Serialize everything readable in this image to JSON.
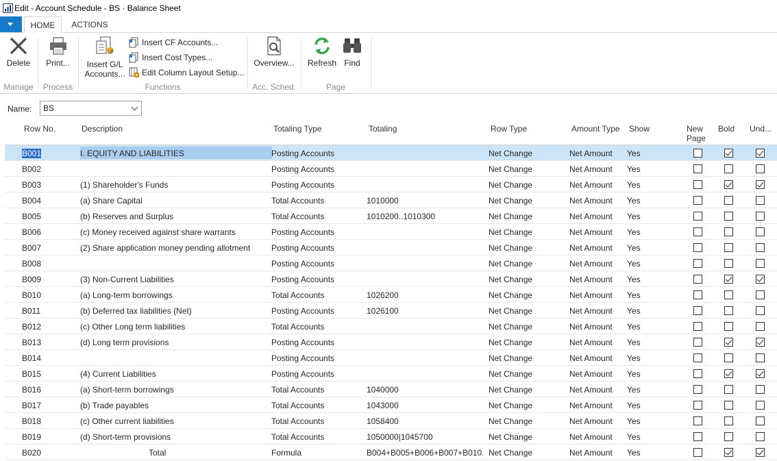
{
  "window": {
    "title": "Edit - Account Schedule - BS · Balance Sheet"
  },
  "tabs": {
    "home": "HOME",
    "actions": "ACTIONS"
  },
  "ribbon": {
    "manage": {
      "label": "Manage",
      "delete": "Delete"
    },
    "process": {
      "label": "Process",
      "print": "Print..."
    },
    "functions": {
      "label": "Functions",
      "insert_gl_line1": "Insert G/L",
      "insert_gl_line2": "Accounts...",
      "insert_cf": "Insert CF Accounts...",
      "insert_cost": "Insert Cost Types...",
      "edit_column": "Edit Column Layout Setup..."
    },
    "acc_sched": {
      "label": "Acc. Sched.",
      "overview": "Overview..."
    },
    "page": {
      "label": "Page",
      "refresh": "Refresh",
      "find": "Find"
    }
  },
  "name_field": {
    "label": "Name:",
    "value": "BS"
  },
  "columns": {
    "row_no": "Row No.",
    "description": "Description",
    "totaling_type": "Totaling Type",
    "totaling": "Totaling",
    "row_type": "Row Type",
    "amount_type": "Amount Type",
    "show": "Show",
    "new_page_1": "New",
    "new_page_2": "Page",
    "bold": "Bold",
    "underline": "Und..."
  },
  "rows": [
    {
      "row_no": "B001",
      "description": "I. EQUITY AND LIABILITIES",
      "totaling_type": "Posting Accounts",
      "totaling": "",
      "row_type": "Net Change",
      "amount_type": "Net Amount",
      "show": "Yes",
      "new_page": false,
      "bold": true,
      "underline": true
    },
    {
      "row_no": "B002",
      "description": "",
      "totaling_type": "Posting Accounts",
      "totaling": "",
      "row_type": "Net Change",
      "amount_type": "Net Amount",
      "show": "Yes",
      "new_page": false,
      "bold": false,
      "underline": false
    },
    {
      "row_no": "B003",
      "description": "(1) Shareholder's Funds",
      "totaling_type": "Posting Accounts",
      "totaling": "",
      "row_type": "Net Change",
      "amount_type": "Net Amount",
      "show": "Yes",
      "new_page": false,
      "bold": true,
      "underline": true
    },
    {
      "row_no": "B004",
      "description": "(a) Share Capital",
      "totaling_type": "Total Accounts",
      "totaling": "1010000",
      "row_type": "Net Change",
      "amount_type": "Net Amount",
      "show": "Yes",
      "new_page": false,
      "bold": false,
      "underline": false
    },
    {
      "row_no": "B005",
      "description": "(b) Reserves and Surplus",
      "totaling_type": "Total Accounts",
      "totaling": "1010200..1010300",
      "row_type": "Net Change",
      "amount_type": "Net Amount",
      "show": "Yes",
      "new_page": false,
      "bold": false,
      "underline": false
    },
    {
      "row_no": "B006",
      "description": "(c) Money received against share warrants",
      "totaling_type": "Posting Accounts",
      "totaling": "",
      "row_type": "Net Change",
      "amount_type": "Net Amount",
      "show": "Yes",
      "new_page": false,
      "bold": false,
      "underline": false
    },
    {
      "row_no": "B007",
      "description": "(2) Share application money pending allotment",
      "totaling_type": "Posting Accounts",
      "totaling": "",
      "row_type": "Net Change",
      "amount_type": "Net Amount",
      "show": "Yes",
      "new_page": false,
      "bold": false,
      "underline": false
    },
    {
      "row_no": "B008",
      "description": "",
      "totaling_type": "Posting Accounts",
      "totaling": "",
      "row_type": "Net Change",
      "amount_type": "Net Amount",
      "show": "Yes",
      "new_page": false,
      "bold": false,
      "underline": false
    },
    {
      "row_no": "B009",
      "description": "(3) Non-Current Liabilities",
      "totaling_type": "Posting Accounts",
      "totaling": "",
      "row_type": "Net Change",
      "amount_type": "Net Amount",
      "show": "Yes",
      "new_page": false,
      "bold": true,
      "underline": true
    },
    {
      "row_no": "B010",
      "description": "(a) Long-term borrowings",
      "totaling_type": "Total Accounts",
      "totaling": "1026200",
      "row_type": "Net Change",
      "amount_type": "Net Amount",
      "show": "Yes",
      "new_page": false,
      "bold": false,
      "underline": false
    },
    {
      "row_no": "B011",
      "description": "(b) Deferred tax liabilities (Net)",
      "totaling_type": "Posting Accounts",
      "totaling": "1026100",
      "row_type": "Net Change",
      "amount_type": "Net Amount",
      "show": "Yes",
      "new_page": false,
      "bold": false,
      "underline": false
    },
    {
      "row_no": "B012",
      "description": "(c) Other Long term liabilities",
      "totaling_type": "Total Accounts",
      "totaling": "",
      "row_type": "Net Change",
      "amount_type": "Net Amount",
      "show": "Yes",
      "new_page": false,
      "bold": false,
      "underline": false
    },
    {
      "row_no": "B013",
      "description": "(d) Long term provisions",
      "totaling_type": "Posting Accounts",
      "totaling": "",
      "row_type": "Net Change",
      "amount_type": "Net Amount",
      "show": "Yes",
      "new_page": false,
      "bold": true,
      "underline": true
    },
    {
      "row_no": "B014",
      "description": "",
      "totaling_type": "Posting Accounts",
      "totaling": "",
      "row_type": "Net Change",
      "amount_type": "Net Amount",
      "show": "Yes",
      "new_page": false,
      "bold": false,
      "underline": false
    },
    {
      "row_no": "B015",
      "description": "(4) Current Liabilities",
      "totaling_type": "Posting Accounts",
      "totaling": "",
      "row_type": "Net Change",
      "amount_type": "Net Amount",
      "show": "Yes",
      "new_page": false,
      "bold": true,
      "underline": true
    },
    {
      "row_no": "B016",
      "description": "(a) Short-term borrowings",
      "totaling_type": "Total Accounts",
      "totaling": "1040000",
      "row_type": "Net Change",
      "amount_type": "Net Amount",
      "show": "Yes",
      "new_page": false,
      "bold": false,
      "underline": false
    },
    {
      "row_no": "B017",
      "description": "(b) Trade payables",
      "totaling_type": "Total Accounts",
      "totaling": "1043000",
      "row_type": "Net Change",
      "amount_type": "Net Amount",
      "show": "Yes",
      "new_page": false,
      "bold": false,
      "underline": false
    },
    {
      "row_no": "B018",
      "description": "(c) Other current liabilities",
      "totaling_type": "Total Accounts",
      "totaling": "1058400",
      "row_type": "Net Change",
      "amount_type": "Net Amount",
      "show": "Yes",
      "new_page": false,
      "bold": false,
      "underline": false
    },
    {
      "row_no": "B019",
      "description": "(d) Short-term provisions",
      "totaling_type": "Total Accounts",
      "totaling": "1050000|1045700",
      "row_type": "Net Change",
      "amount_type": "Net Amount",
      "show": "Yes",
      "new_page": false,
      "bold": false,
      "underline": false
    },
    {
      "row_no": "B020",
      "description": "Total",
      "totaling_type": "Formula",
      "totaling": "B004+B005+B006+B007+B010...",
      "row_type": "Net Change",
      "amount_type": "Net Amount",
      "show": "Yes",
      "new_page": false,
      "bold": true,
      "underline": true
    }
  ]
}
